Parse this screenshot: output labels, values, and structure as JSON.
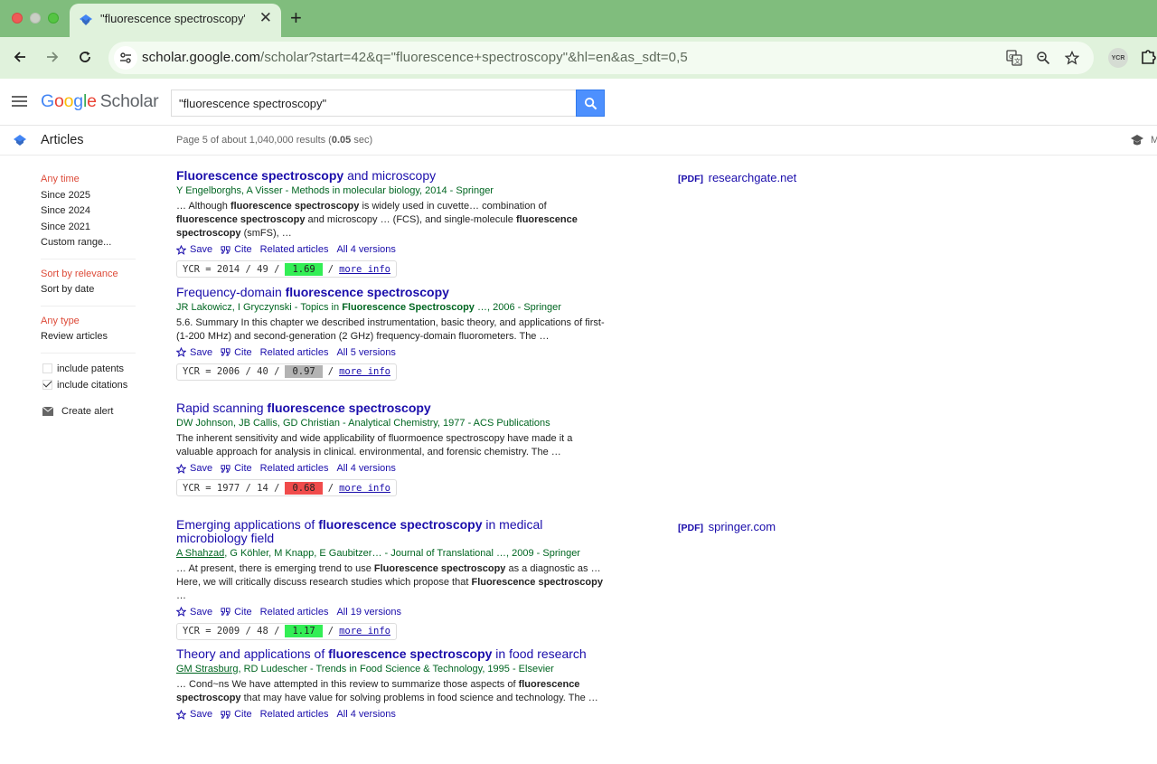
{
  "browser": {
    "tab_title": "\"fluorescence spectroscopy\"",
    "url_host": "scholar.google.com",
    "url_path": "/scholar?start=42&q=\"fluorescence+spectroscopy\"&hl=en&as_sdt=0,5",
    "extension_label": "YCR"
  },
  "header": {
    "logo_scholar": "Scholar",
    "search_value": "\"fluorescence spectroscopy\""
  },
  "subheader": {
    "articles_label": "Articles",
    "result_stats_prefix": "Page 5 of about 1,040,000 results (",
    "result_stats_time": "0.05",
    "result_stats_suffix": " sec)",
    "my_library_label": "M"
  },
  "sidebar": {
    "time": [
      "Any time",
      "Since 2025",
      "Since 2024",
      "Since 2021",
      "Custom range..."
    ],
    "sort": [
      "Sort by relevance",
      "Sort by date"
    ],
    "type": [
      "Any type",
      "Review articles"
    ],
    "include_patents": "include patents",
    "include_citations": "include citations",
    "create_alert": "Create alert"
  },
  "actions": {
    "save": "Save",
    "cite": "Cite",
    "related": "Related articles",
    "more_info": "more info"
  },
  "results": [
    {
      "title_html": "<b>Fluorescence spectroscopy</b> and microscopy",
      "authors_html": "Y Engelborghs, A Visser - Methods in molecular biology, 2014 - Springer",
      "snippet_html": "… Although <b>fluorescence spectroscopy</b> is widely used in cuvette… combination of <b>fluorescence spectroscopy</b> and microscopy … (FCS), and single-molecule <b>fluorescence spectroscopy</b> (smFS), …",
      "versions": "All 4 versions",
      "ycr_text": "YCR = 2014 / 49 /",
      "ycr_score": "1.69",
      "score_color": "#33ee55",
      "side_tag": "[PDF]",
      "side_domain": "researchgate.net"
    },
    {
      "title_html": "Frequency-domain <b>fluorescence spectroscopy</b>",
      "authors_html": "JR Lakowicz, I Gryczynski - Topics in <b>Fluorescence Spectroscopy</b> …, 2006 - Springer",
      "snippet_html": "5.6. Summary In this chapter we described instrumentation, basic theory, and applications of first- (1-200 MHz) and second-generation (2 GHz) frequency-domain fluorometers. The …",
      "versions": "All 5 versions",
      "ycr_text": "YCR = 2006 / 40 /",
      "ycr_score": "0.97",
      "score_color": "#b3b3b3",
      "side_tag": "",
      "side_domain": ""
    },
    {
      "title_html": "Rapid scanning <b>fluorescence spectroscopy</b>",
      "authors_html": "DW Johnson, JB Callis, GD Christian - Analytical Chemistry, 1977 - ACS Publications",
      "snippet_html": "The inherent sensitivity and wide applicability of fluormoence spectroscopy have made it a valuable approach for analysis in clinical. environmental, and forensic chemistry. The …",
      "versions": "All 4 versions",
      "ycr_text": "YCR = 1977 / 14 /",
      "ycr_score": "0.68",
      "score_color": "#f04b4b",
      "side_tag": "",
      "side_domain": ""
    },
    {
      "title_html": "Emerging applications of <b>fluorescence spectroscopy</b> in medical microbiology field",
      "authors_html": "<span class=\"ul\">A Shahzad</span>, G Köhler, M Knapp, E Gaubitzer… - Journal of Translational …, 2009 - Springer",
      "snippet_html": "… At present, there is emerging trend to use <b>Fluorescence spectroscopy</b> as a diagnostic as … Here, we will critically discuss research studies which propose that <b>Fluorescence spectroscopy</b> …",
      "versions": "All 19 versions",
      "ycr_text": "YCR = 2009 / 48 /",
      "ycr_score": "1.17",
      "score_color": "#33ee55",
      "side_tag": "[PDF]",
      "side_domain": "springer.com"
    },
    {
      "title_html": "Theory and applications of <b>fluorescence spectroscopy</b> in food research",
      "authors_html": "<span class=\"ul\">GM Strasburg</span>, RD Ludescher - Trends in Food Science &amp; Technology, 1995 - Elsevier",
      "snippet_html": "… Cond~ns We have attempted in this review to summarize those aspects of <b>fluorescence spectroscopy</b> that may have value for solving problems in food science and technology. The …",
      "versions": "All 4 versions",
      "ycr_text": "",
      "ycr_score": "",
      "score_color": "",
      "side_tag": "",
      "side_domain": ""
    }
  ]
}
